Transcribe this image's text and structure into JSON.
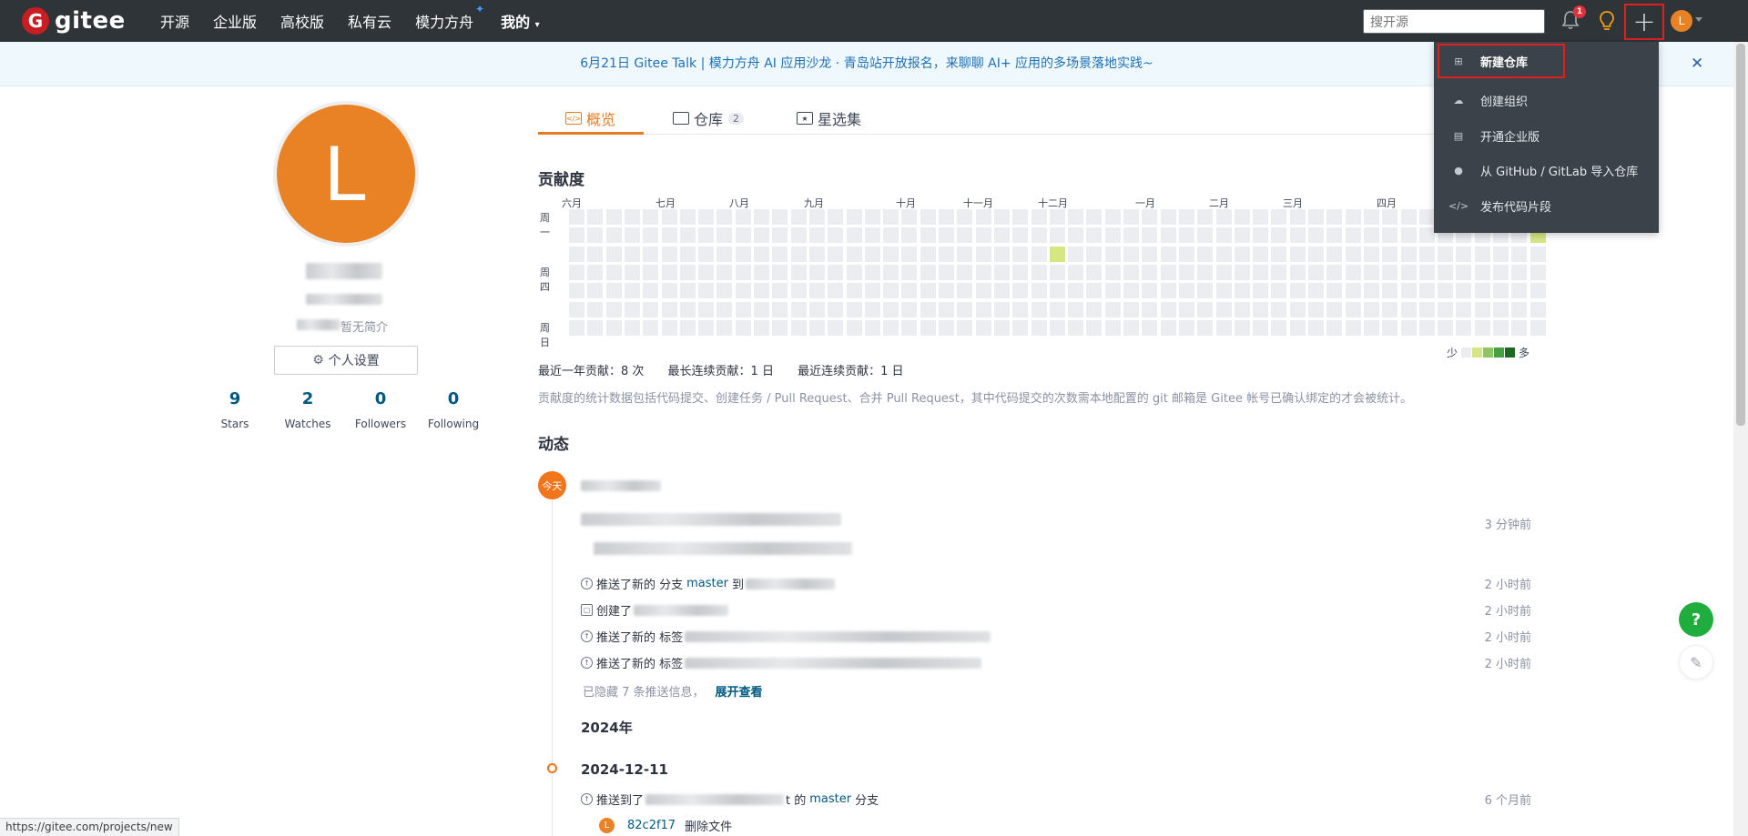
{
  "nav": {
    "logo_letter": "G",
    "logo_text": "gitee",
    "links": [
      "开源",
      "企业版",
      "高校版",
      "私有云",
      "模力方舟"
    ],
    "mine": "我的",
    "search_placeholder": "搜开源",
    "notif_count": "1",
    "avatar_letter": "L"
  },
  "banner": {
    "text": "6月21日 Gitee Talk | 模力方舟 AI 应用沙龙 · 青岛站开放报名，来聊聊 AI+ 应用的多场景落地实践~",
    "close": "✕"
  },
  "profile": {
    "avatar_letter": "L",
    "bio_suffix": "暂无简介",
    "settings_label": "个人设置",
    "stats": [
      {
        "num": "9",
        "label": "Stars"
      },
      {
        "num": "2",
        "label": "Watches"
      },
      {
        "num": "0",
        "label": "Followers"
      },
      {
        "num": "0",
        "label": "Following"
      }
    ]
  },
  "tabs": [
    {
      "label": "概览"
    },
    {
      "label": "仓库",
      "count": "2"
    },
    {
      "label": "星选集"
    }
  ],
  "contribution": {
    "title": "贡献度",
    "months": [
      "六月",
      "七月",
      "八月",
      "九月",
      "十月",
      "十一月",
      "十二月",
      "一月",
      "二月",
      "三月",
      "四月"
    ],
    "weekdays": [
      "周一",
      "周四",
      "周日"
    ],
    "legend_less": "少",
    "legend_more": "多",
    "summary_year": "最近一年贡献：8 次",
    "summary_longest": "最长连续贡献：1 日",
    "summary_recent": "最近连续贡献：1 日",
    "note": "贡献度的统计数据包括代码提交、创建任务 / Pull Request、合并 Pull Request，其中代码提交的次数需本地配置的 git 邮箱是 Gitee 帐号已确认绑定的才会被统计。",
    "colors": {
      "empty": "#ebedf0",
      "l1": "#d6e685",
      "l2": "#8cc665",
      "l3": "#44a340",
      "l4": "#1e6823"
    }
  },
  "activity": {
    "title": "动态",
    "today": "今天",
    "items": [
      {
        "time": "3 分钟前"
      },
      {
        "text_a": "推送了新的 分支",
        "branch": "master",
        "text_b": "到",
        "time": "2 小时前"
      },
      {
        "text_a": "创建了",
        "time": "2 小时前"
      },
      {
        "text_a": "推送了新的 标签",
        "time": "2 小时前"
      },
      {
        "text_a": "推送了新的 标签",
        "time": "2 小时前"
      }
    ],
    "hidden_text": "已隐藏 7 条推送信息，",
    "hidden_link": "展开查看",
    "year": "2024年",
    "date": "2024-12-11",
    "push_a": "推送到了",
    "push_mid": "t 的",
    "push_branch": "master",
    "push_b": "分支",
    "push_time": "6 个月前",
    "commit_avatar": "L",
    "commit_hash": "82c2f17",
    "commit_msg": "删除文件"
  },
  "dropdown": {
    "items": [
      {
        "label": "新建仓库",
        "icon": "plus-square-icon"
      },
      {
        "label": "创建组织",
        "icon": "group-icon"
      },
      {
        "label": "开通企业版",
        "icon": "building-icon"
      },
      {
        "label": "从 GitHub / GitLab 导入仓库",
        "icon": "github-icon"
      },
      {
        "label": "发布代码片段",
        "icon": "code-icon"
      }
    ]
  },
  "floating": {
    "help": "?",
    "feedback": "✎"
  },
  "status_url": "https://gitee.com/projects/new"
}
